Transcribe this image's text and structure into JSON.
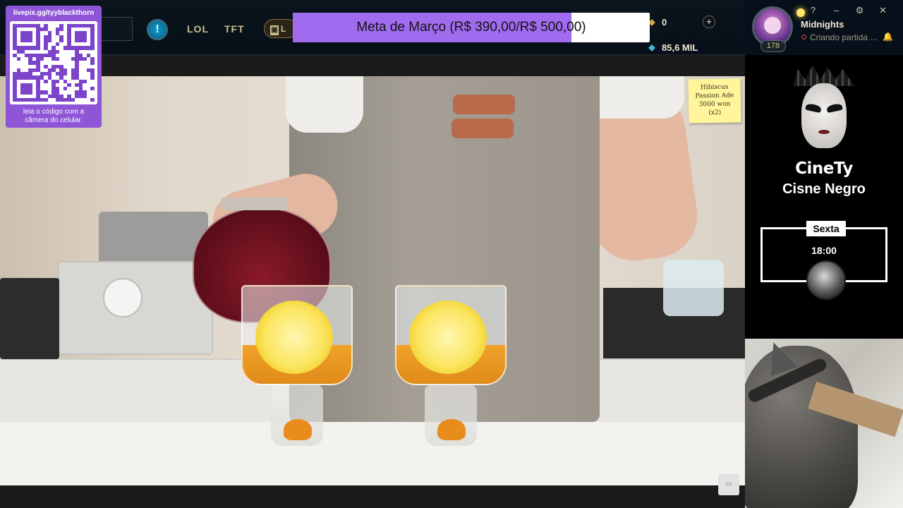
{
  "client": {
    "nav_tabs": [
      {
        "label": "LOL"
      },
      {
        "label": "TFT"
      }
    ],
    "play_button_label": "L",
    "currency": {
      "riot_points": "0",
      "blue_essence": "85,6 MIL"
    },
    "profile": {
      "name": "Midnights",
      "status": "Criando partida ...",
      "level": "178"
    },
    "window_controls": [
      "?",
      "–",
      "⚙",
      "✕"
    ],
    "colors": {
      "gold": "#cdbe91",
      "background": "#07101a",
      "status_red": "#e04848"
    }
  },
  "goal": {
    "label": "Meta de Março (R$ 390,00/R$ 500,00)",
    "current": 390,
    "target": 500,
    "fill_color": "#a06bee"
  },
  "qr_widget": {
    "url": "livepix.gg/tyyblackthorn",
    "caption_line1": "leia o código com a",
    "caption_line2": "câmera do celular.",
    "color": "#8e55d6"
  },
  "video": {
    "sticky_note": {
      "line1": "Hibiscus",
      "line2": "Passion Ade",
      "line3": "3000 won",
      "line4": "(x2)"
    }
  },
  "sidebar": {
    "title": "CineTy",
    "subtitle": "Cisne Negro",
    "schedule": {
      "day": "Sexta",
      "time": "18:00"
    }
  }
}
